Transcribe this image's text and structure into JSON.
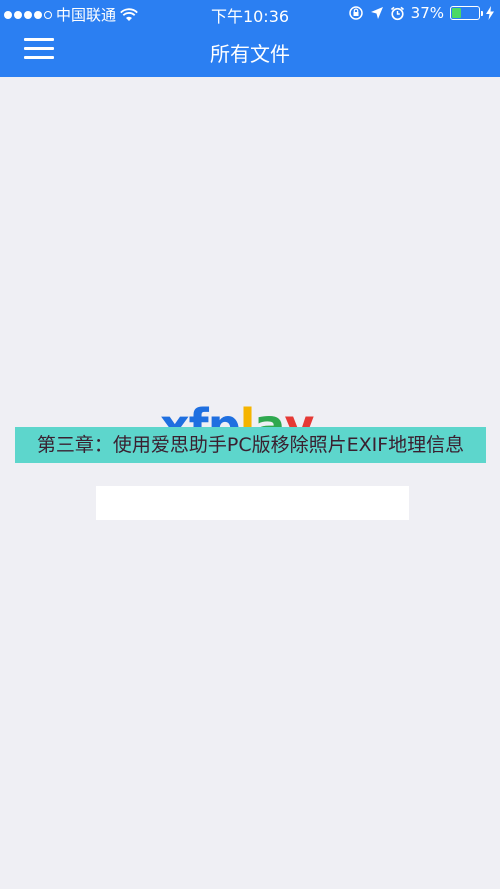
{
  "status_bar": {
    "carrier": "中国联通",
    "time": "下午10:36",
    "battery_percent": "37%",
    "battery_level": 0.37,
    "icons": [
      "signal-dots-icon",
      "wifi-icon",
      "orientation-lock-icon",
      "location-arrow-icon",
      "alarm-icon",
      "battery-icon",
      "charging-bolt-icon"
    ]
  },
  "nav": {
    "title": "所有文件",
    "menu_icon": "hamburger-menu-icon"
  },
  "logo": {
    "text": "xfplay",
    "colors": {
      "x": "#1f6fe0",
      "f": "#1f6fe0",
      "p": "#1f6fe0",
      "l": "#f5b400",
      "a": "#2fa84f",
      "y": "#e53935"
    }
  },
  "caption": {
    "text": "第三章：使用爱思助手PC版移除照片EXIF地理信息"
  },
  "colors": {
    "nav_bg": "#2b7ff2",
    "page_bg": "#efeff4",
    "caption_bg": "#5dd6cc"
  }
}
